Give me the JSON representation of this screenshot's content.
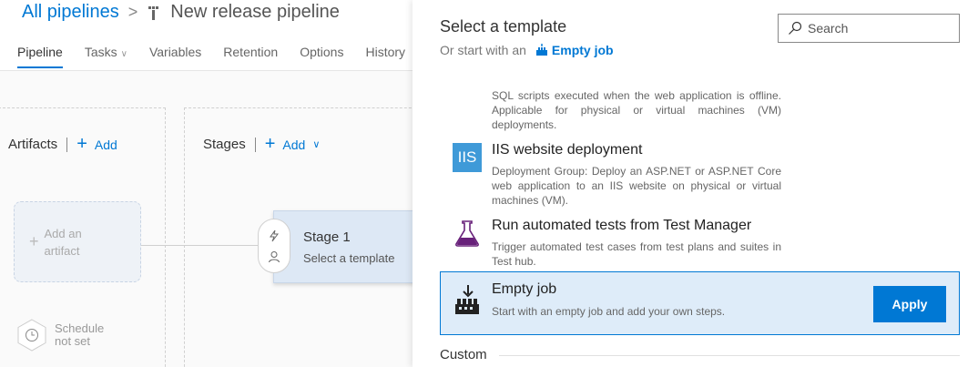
{
  "breadcrumb": {
    "root": "All pipelines",
    "separator": ">",
    "title": "New release pipeline"
  },
  "tabs": [
    {
      "label": "Pipeline",
      "active": true
    },
    {
      "label": "Tasks",
      "has_dropdown": true
    },
    {
      "label": "Variables"
    },
    {
      "label": "Retention"
    },
    {
      "label": "Options"
    },
    {
      "label": "History"
    }
  ],
  "artifacts": {
    "title": "Artifacts",
    "add_label": "Add",
    "card_line1": "Add an",
    "card_line2": "artifact"
  },
  "stages": {
    "title": "Stages",
    "add_label": "Add",
    "stage_name": "Stage 1",
    "stage_sub": "Select a template"
  },
  "schedule": {
    "line1": "Schedule",
    "line2": "not set"
  },
  "panel": {
    "title": "Select a template",
    "subtitle": "Or start with an",
    "empty_job_link": "Empty job",
    "search_placeholder": "Search"
  },
  "templates": [
    {
      "name": "",
      "desc": "SQL scripts executed when the web application is offline. Applicable for physical or virtual machines (VM) deployments."
    },
    {
      "name": "IIS website deployment",
      "icon_text": "IIS",
      "icon": "iis-icon",
      "desc": "Deployment Group: Deploy an ASP.NET or ASP.NET Core web application to an IIS website on physical or virtual machines (VM)."
    },
    {
      "name": "Run automated tests from Test Manager",
      "icon": "flask-icon",
      "desc": "Trigger automated test cases from test plans and suites in Test hub."
    }
  ],
  "selected_template": {
    "name": "Empty job",
    "icon": "empty-job-icon",
    "desc": "Start with an empty job and add your own steps.",
    "apply_label": "Apply"
  },
  "custom_section": "Custom",
  "colors": {
    "accent": "#0078d4",
    "selected_bg": "#deecf9",
    "iis_blue": "#3f9ad8",
    "flask_purple": "#68217a"
  }
}
